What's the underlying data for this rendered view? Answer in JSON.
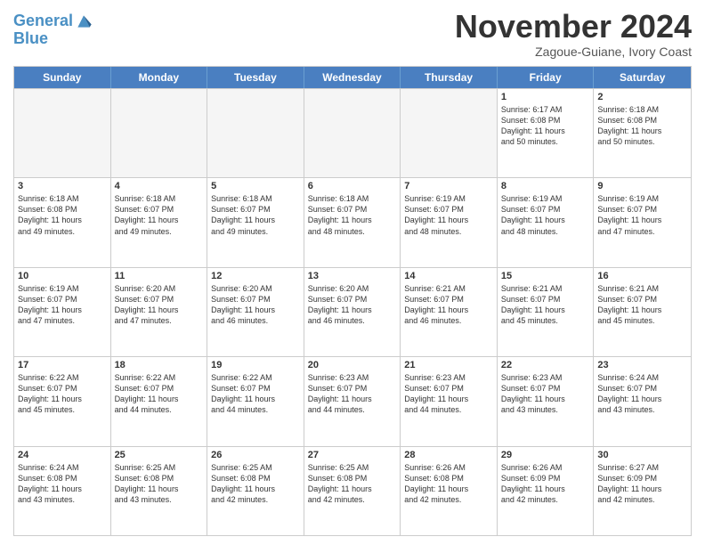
{
  "logo": {
    "line1": "General",
    "line2": "Blue"
  },
  "header": {
    "month": "November 2024",
    "location": "Zagoue-Guiane, Ivory Coast"
  },
  "weekdays": [
    "Sunday",
    "Monday",
    "Tuesday",
    "Wednesday",
    "Thursday",
    "Friday",
    "Saturday"
  ],
  "weeks": [
    [
      {
        "day": "",
        "info": "",
        "empty": true
      },
      {
        "day": "",
        "info": "",
        "empty": true
      },
      {
        "day": "",
        "info": "",
        "empty": true
      },
      {
        "day": "",
        "info": "",
        "empty": true
      },
      {
        "day": "",
        "info": "",
        "empty": true
      },
      {
        "day": "1",
        "info": "Sunrise: 6:17 AM\nSunset: 6:08 PM\nDaylight: 11 hours\nand 50 minutes.",
        "empty": false
      },
      {
        "day": "2",
        "info": "Sunrise: 6:18 AM\nSunset: 6:08 PM\nDaylight: 11 hours\nand 50 minutes.",
        "empty": false
      }
    ],
    [
      {
        "day": "3",
        "info": "Sunrise: 6:18 AM\nSunset: 6:08 PM\nDaylight: 11 hours\nand 49 minutes.",
        "empty": false
      },
      {
        "day": "4",
        "info": "Sunrise: 6:18 AM\nSunset: 6:07 PM\nDaylight: 11 hours\nand 49 minutes.",
        "empty": false
      },
      {
        "day": "5",
        "info": "Sunrise: 6:18 AM\nSunset: 6:07 PM\nDaylight: 11 hours\nand 49 minutes.",
        "empty": false
      },
      {
        "day": "6",
        "info": "Sunrise: 6:18 AM\nSunset: 6:07 PM\nDaylight: 11 hours\nand 48 minutes.",
        "empty": false
      },
      {
        "day": "7",
        "info": "Sunrise: 6:19 AM\nSunset: 6:07 PM\nDaylight: 11 hours\nand 48 minutes.",
        "empty": false
      },
      {
        "day": "8",
        "info": "Sunrise: 6:19 AM\nSunset: 6:07 PM\nDaylight: 11 hours\nand 48 minutes.",
        "empty": false
      },
      {
        "day": "9",
        "info": "Sunrise: 6:19 AM\nSunset: 6:07 PM\nDaylight: 11 hours\nand 47 minutes.",
        "empty": false
      }
    ],
    [
      {
        "day": "10",
        "info": "Sunrise: 6:19 AM\nSunset: 6:07 PM\nDaylight: 11 hours\nand 47 minutes.",
        "empty": false
      },
      {
        "day": "11",
        "info": "Sunrise: 6:20 AM\nSunset: 6:07 PM\nDaylight: 11 hours\nand 47 minutes.",
        "empty": false
      },
      {
        "day": "12",
        "info": "Sunrise: 6:20 AM\nSunset: 6:07 PM\nDaylight: 11 hours\nand 46 minutes.",
        "empty": false
      },
      {
        "day": "13",
        "info": "Sunrise: 6:20 AM\nSunset: 6:07 PM\nDaylight: 11 hours\nand 46 minutes.",
        "empty": false
      },
      {
        "day": "14",
        "info": "Sunrise: 6:21 AM\nSunset: 6:07 PM\nDaylight: 11 hours\nand 46 minutes.",
        "empty": false
      },
      {
        "day": "15",
        "info": "Sunrise: 6:21 AM\nSunset: 6:07 PM\nDaylight: 11 hours\nand 45 minutes.",
        "empty": false
      },
      {
        "day": "16",
        "info": "Sunrise: 6:21 AM\nSunset: 6:07 PM\nDaylight: 11 hours\nand 45 minutes.",
        "empty": false
      }
    ],
    [
      {
        "day": "17",
        "info": "Sunrise: 6:22 AM\nSunset: 6:07 PM\nDaylight: 11 hours\nand 45 minutes.",
        "empty": false
      },
      {
        "day": "18",
        "info": "Sunrise: 6:22 AM\nSunset: 6:07 PM\nDaylight: 11 hours\nand 44 minutes.",
        "empty": false
      },
      {
        "day": "19",
        "info": "Sunrise: 6:22 AM\nSunset: 6:07 PM\nDaylight: 11 hours\nand 44 minutes.",
        "empty": false
      },
      {
        "day": "20",
        "info": "Sunrise: 6:23 AM\nSunset: 6:07 PM\nDaylight: 11 hours\nand 44 minutes.",
        "empty": false
      },
      {
        "day": "21",
        "info": "Sunrise: 6:23 AM\nSunset: 6:07 PM\nDaylight: 11 hours\nand 44 minutes.",
        "empty": false
      },
      {
        "day": "22",
        "info": "Sunrise: 6:23 AM\nSunset: 6:07 PM\nDaylight: 11 hours\nand 43 minutes.",
        "empty": false
      },
      {
        "day": "23",
        "info": "Sunrise: 6:24 AM\nSunset: 6:07 PM\nDaylight: 11 hours\nand 43 minutes.",
        "empty": false
      }
    ],
    [
      {
        "day": "24",
        "info": "Sunrise: 6:24 AM\nSunset: 6:08 PM\nDaylight: 11 hours\nand 43 minutes.",
        "empty": false
      },
      {
        "day": "25",
        "info": "Sunrise: 6:25 AM\nSunset: 6:08 PM\nDaylight: 11 hours\nand 43 minutes.",
        "empty": false
      },
      {
        "day": "26",
        "info": "Sunrise: 6:25 AM\nSunset: 6:08 PM\nDaylight: 11 hours\nand 42 minutes.",
        "empty": false
      },
      {
        "day": "27",
        "info": "Sunrise: 6:25 AM\nSunset: 6:08 PM\nDaylight: 11 hours\nand 42 minutes.",
        "empty": false
      },
      {
        "day": "28",
        "info": "Sunrise: 6:26 AM\nSunset: 6:08 PM\nDaylight: 11 hours\nand 42 minutes.",
        "empty": false
      },
      {
        "day": "29",
        "info": "Sunrise: 6:26 AM\nSunset: 6:09 PM\nDaylight: 11 hours\nand 42 minutes.",
        "empty": false
      },
      {
        "day": "30",
        "info": "Sunrise: 6:27 AM\nSunset: 6:09 PM\nDaylight: 11 hours\nand 42 minutes.",
        "empty": false
      }
    ]
  ]
}
